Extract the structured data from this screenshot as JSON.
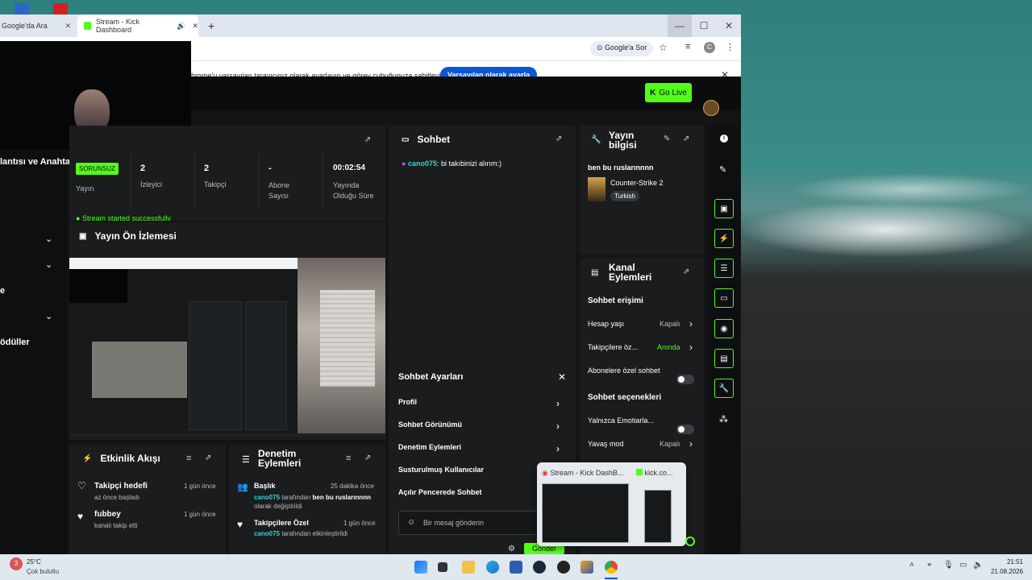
{
  "browser": {
    "tabs": [
      {
        "label": "Google'da Ara"
      },
      {
        "label": "Stream - Kick Dashboard"
      }
    ],
    "new_tab": "+",
    "search_chip": "Google'a Sor",
    "profile_initial": "C",
    "infobar_text": "hrome'u varsayılan tarayıcınız olarak ayarlayın ve görev çubuğunuza sabitleyin",
    "infobar_button": "Varsayılan olarak ayarla"
  },
  "topbar": {
    "go_live": "Go Live"
  },
  "left_sidebar": {
    "items": [
      "lantısı ve Anahta",
      "e",
      "ödüller"
    ]
  },
  "stats": {
    "status_badge": "SORUNSUZ",
    "status_label": "Yayın",
    "viewers_value": "2",
    "viewers_label": "İzleyici",
    "followers_value": "2",
    "followers_label": "Takipçi",
    "subs_value": "-",
    "subs_label": "Abone Sayısı",
    "uptime_value": "00:02:54",
    "uptime_label": "Yayında Olduğu Süre",
    "notice": "Stream started successfully"
  },
  "preview": {
    "title": "Yayın Ön İzlemesi"
  },
  "activity": {
    "title": "Etkinlik Akışı",
    "items": [
      {
        "title": "Takipçi hedefi",
        "sub": "az önce başladı",
        "time": "1 gün önce"
      },
      {
        "title": "fubbey",
        "sub": "kanalı takip etti",
        "time": "1 gün önce"
      }
    ]
  },
  "moderation": {
    "title": "Denetim Eylemleri",
    "items": [
      {
        "title": "Başlık",
        "time": "25 dakika önce",
        "user": "cano075",
        "mid": " tarafından ",
        "bold": "ben bu ruslarınnnn",
        "tail": "olarak değiştirildi"
      },
      {
        "title": "Takipçilere Özel",
        "time": "1 gün önce",
        "user": "cano075",
        "mid": " tarafından etkinleştirildi",
        "bold": "",
        "tail": ""
      }
    ]
  },
  "chat": {
    "title": "Sohbet",
    "message_user": "cano075",
    "message_text": ": bi takıbinizi alırım:)",
    "settings_title": "Sohbet Ayarları",
    "settings_items": [
      "Profil",
      "Sohbet Görünümü",
      "Denetim Eylemleri",
      "Susturulmuş Kullanıcılar",
      "Açılır Pencerede Sohbet"
    ],
    "input_placeholder": "Bir mesaj gönderin",
    "send": "Gönder"
  },
  "stream_info": {
    "title_line1": "Yayın",
    "title_line2": "bilgisi",
    "stream_title": "ben bu ruslarınnnn",
    "game": "Counter-Strike 2",
    "language": "Turkish"
  },
  "channel_actions": {
    "title_line1": "Kanal",
    "title_line2": "Eylemleri",
    "chat_access": "Sohbet erişimi",
    "account_age": "Hesap yaşı",
    "account_age_value": "Kapalı",
    "followers_only": "Takipçilere öz...",
    "followers_only_value": "Anında",
    "subs_only": "Abonelere özel sohbet",
    "chat_options": "Sohbet seçenekleri",
    "emotes_only": "Yalnızca Emotiarla...",
    "slow_mode": "Yavaş mod",
    "slow_mode_value": "Kapalı"
  },
  "taskbar_preview": {
    "item1": "Stream - Kick DashB...",
    "item2": "kick.co..."
  },
  "taskbar": {
    "temp": "25°C",
    "weather": "Çok bulutlu",
    "badge": "3",
    "time": "21:51",
    "date": "21.08.2026"
  },
  "colors": {
    "kick_green": "#53fc18",
    "panel_bg": "#1a1c1e",
    "accent_blue": "#0b57d0"
  }
}
